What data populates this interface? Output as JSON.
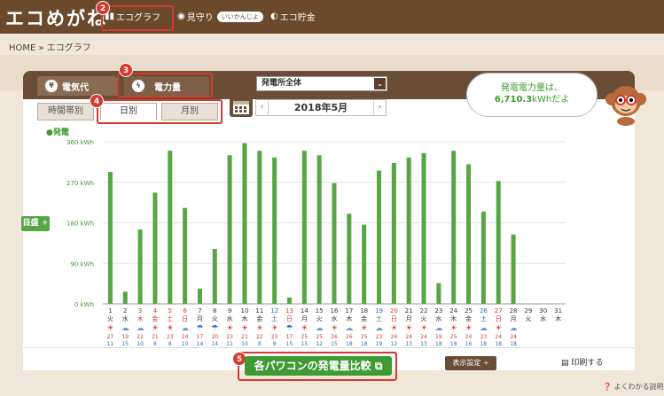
{
  "header": {
    "logo": "エコめがね",
    "nav": [
      {
        "label": "エコグラフ"
      },
      {
        "label": "見守り",
        "badge": "いいかんじよ"
      },
      {
        "label": "エコ貯金"
      }
    ]
  },
  "breadcrumb": "HOME » エコグラフ",
  "callout_numbers": [
    "2",
    "3",
    "4",
    "5"
  ],
  "tabs": {
    "denki": "電気代",
    "denryoku": "電力量"
  },
  "plant_select": "発電所全体",
  "subtabs": {
    "time": "時間帯別",
    "day": "日別",
    "month": "月別"
  },
  "month_nav": {
    "label": "2018年5月",
    "prev": "‹",
    "next": "›"
  },
  "bubble": {
    "line1": "発電電力量は、",
    "value": "6,710.3",
    "unit": "kWhだよ"
  },
  "legend": "●発電",
  "side_button": "目盛 ÷",
  "chart_data": {
    "type": "bar",
    "ylabel": "",
    "ylim": [
      0,
      360
    ],
    "yticks": [
      "0 kWh",
      "90 kWh",
      "180 kWh",
      "270 kWh",
      "360 kWh"
    ],
    "series": [
      {
        "name": "発電",
        "color": "#57a544",
        "values": [
          293,
          27,
          165,
          247,
          340,
          213,
          34,
          122,
          330,
          357,
          340,
          325,
          14,
          340,
          330,
          268,
          200,
          176,
          296,
          313,
          325,
          335,
          46,
          340,
          310,
          205,
          273,
          154,
          0,
          0,
          0
        ]
      }
    ],
    "categories": [
      "1",
      "2",
      "3",
      "4",
      "5",
      "6",
      "7",
      "8",
      "9",
      "10",
      "11",
      "12",
      "13",
      "14",
      "15",
      "16",
      "17",
      "18",
      "19",
      "20",
      "21",
      "22",
      "23",
      "24",
      "25",
      "26",
      "27",
      "28",
      "29",
      "30",
      "31"
    ],
    "weekdays": [
      "火",
      "水",
      "木",
      "金",
      "土",
      "日",
      "月",
      "火",
      "水",
      "木",
      "金",
      "土",
      "日",
      "月",
      "火",
      "水",
      "木",
      "金",
      "土",
      "日",
      "月",
      "火",
      "水",
      "木",
      "金",
      "土",
      "日",
      "月",
      "火",
      "水",
      "木"
    ],
    "weekday_colors": [
      "#333",
      "#333",
      "#d23b2e",
      "#d23b2e",
      "#d23b2e",
      "#d23b2e",
      "#333",
      "#333",
      "#333",
      "#333",
      "#333",
      "#2d6bc4",
      "#d23b2e",
      "#333",
      "#333",
      "#333",
      "#333",
      "#333",
      "#2d6bc4",
      "#d23b2e",
      "#333",
      "#333",
      "#333",
      "#333",
      "#333",
      "#2d6bc4",
      "#d23b2e",
      "#333",
      "#333",
      "#333",
      "#333"
    ],
    "weather": [
      "sun",
      "cloud",
      "cloud",
      "sun",
      "sun",
      "cloud",
      "rain",
      "rain",
      "sun",
      "sun",
      "sun",
      "sun",
      "rain",
      "sun",
      "cloud",
      "sun",
      "cloud",
      "sun",
      "cloud",
      "sun",
      "sun",
      "sun",
      "cloud",
      "sun",
      "sun",
      "cloud",
      "sun",
      "cloud",
      "",
      "",
      ""
    ],
    "temp_high": [
      "27",
      "19",
      "22",
      "21",
      "23",
      "24",
      "17",
      "20",
      "23",
      "21",
      "22",
      "23",
      "17",
      "25",
      "25",
      "26",
      "26",
      "25",
      "23",
      "24",
      "24",
      "24",
      "19",
      "25",
      "24",
      "23",
      "24",
      "24",
      "",
      "",
      ""
    ],
    "temp_low": [
      "11",
      "15",
      "10",
      "8",
      "8",
      "10",
      "14",
      "14",
      "11",
      "10",
      "8",
      "8",
      "15",
      "15",
      "12",
      "15",
      "18",
      "18",
      "19",
      "12",
      "13",
      "13",
      "18",
      "18",
      "16",
      "18",
      "18",
      "18",
      "",
      "",
      ""
    ]
  },
  "buttons": {
    "compare": "各パワコンの発電量比較",
    "display_settings": "表示設定 ÷",
    "print": "印刷する",
    "help": "よくわかる説明"
  },
  "colors": {
    "brown": "#6b4a2b",
    "green": "#57a544",
    "red": "#d23b2e"
  }
}
